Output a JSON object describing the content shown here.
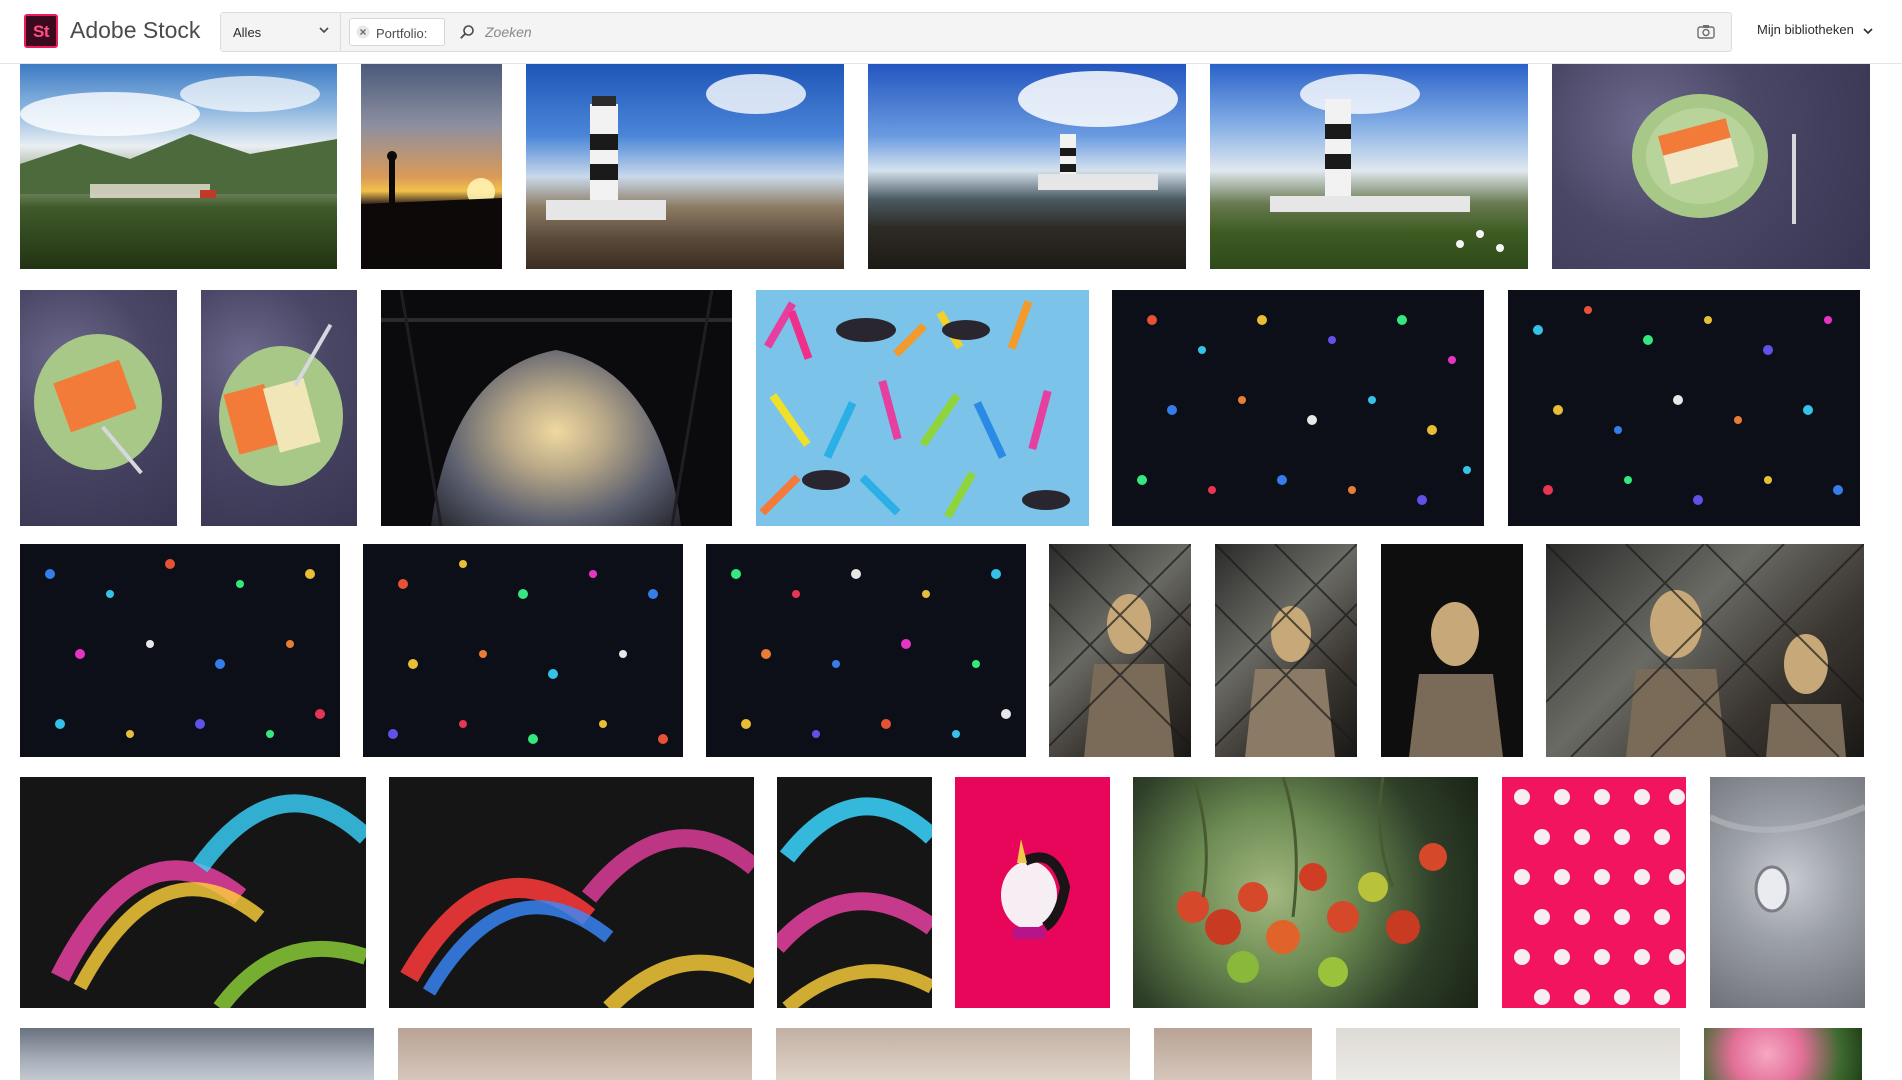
{
  "header": {
    "logo_text": "St",
    "brand": "Adobe Stock",
    "filter_selected": "Alles",
    "chip_label": "Portfolio:",
    "search_placeholder": "Zoeken",
    "libraries_label": "Mijn bibliotheken"
  },
  "colors": {
    "accent": "#ee1c5b",
    "logo_bg": "#3c0a1f"
  },
  "icons": {
    "dropdown": "chevron-down-icon",
    "chip_remove": "close-icon",
    "search": "search-icon",
    "visual_search": "camera-icon",
    "libraries": "chevron-down-icon"
  },
  "results": {
    "rows": [
      [
        "mountain village landscape",
        "sunset silhouette",
        "lighthouse",
        "lighthouse coast",
        "lighthouse meadow",
        "cake slice on plate"
      ],
      [
        "cake slice on plate",
        "two cake slices on plate",
        "eiffel tower arch",
        "colorful pasta shapes",
        "holographic star sparkles",
        "holographic star sparkles"
      ],
      [
        "holographic sparkles",
        "holographic sparkles",
        "holographic sparkles",
        "mannequin behind fence",
        "mannequin reflection",
        "mannequin",
        "mannequins behind fence"
      ],
      [
        "holographic rainbow arcs",
        "holographic rainbow arcs",
        "holographic rainbow arcs",
        "unicorn on pink",
        "cherry tomatoes on vine",
        "unicorn pattern on pink",
        "silver object"
      ],
      [
        "cloudy sky",
        "beige backdrop",
        "beige backdrop",
        "beige backdrop",
        "light backdrop",
        "pink roses"
      ]
    ]
  }
}
